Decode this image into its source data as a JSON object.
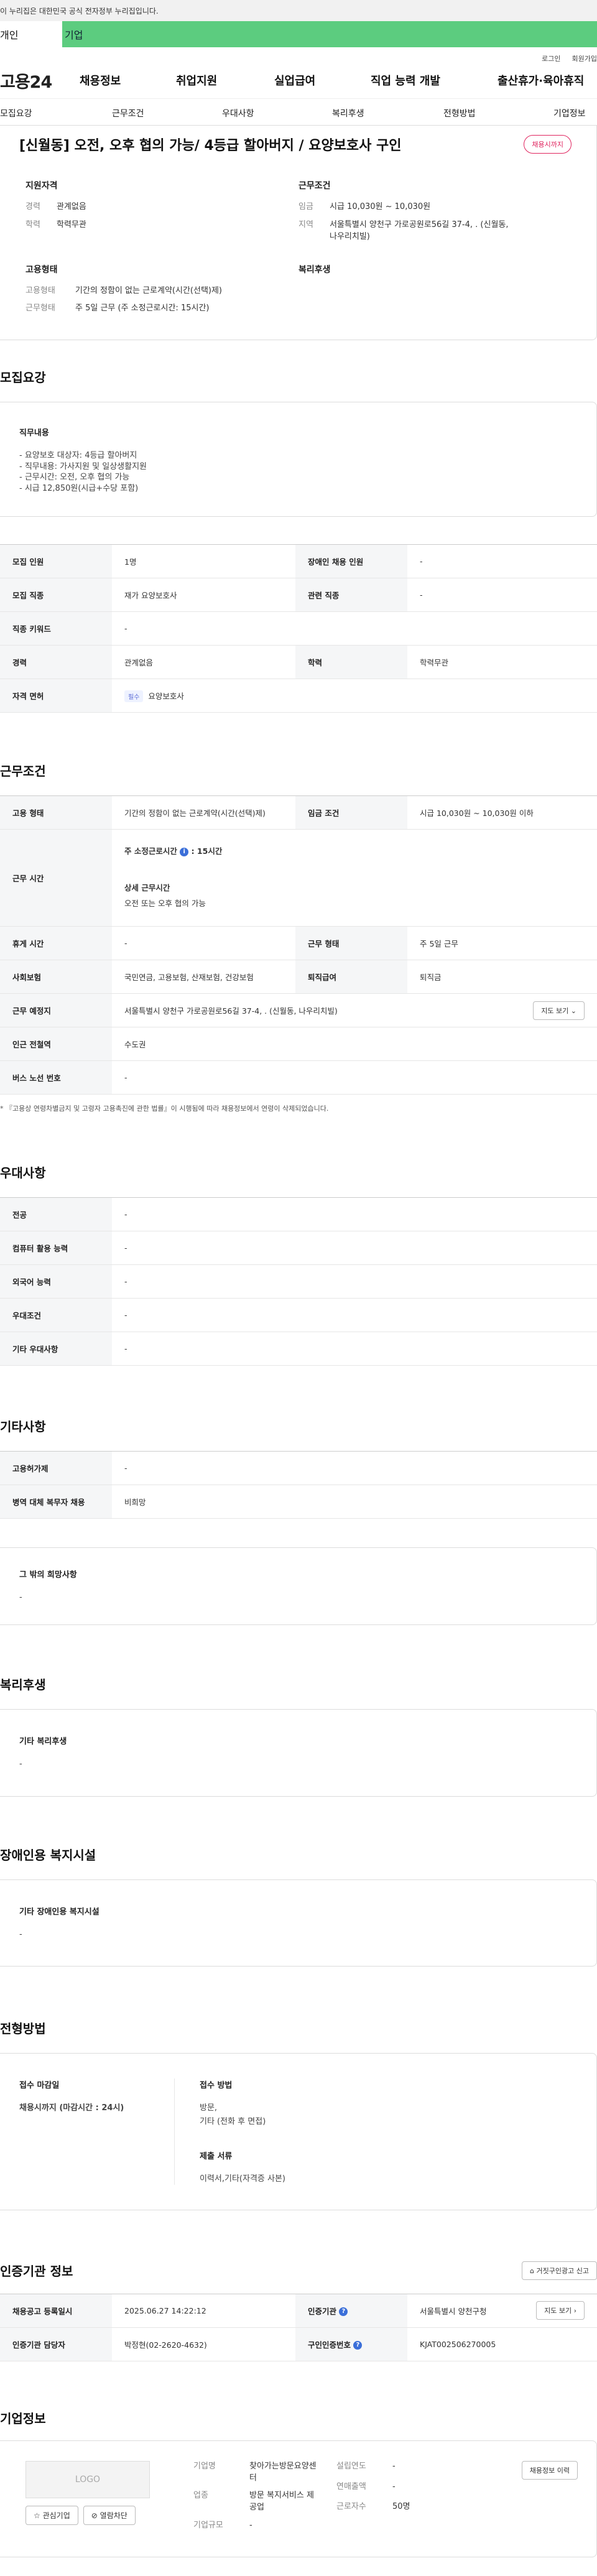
{
  "gov_bar": {
    "text": "이 누리집은 대한민국 공식 전자정부 누리집입니다."
  },
  "top_tabs": {
    "personal": "개인",
    "company": "기업"
  },
  "util": {
    "login": "로그인",
    "join": "회원가입"
  },
  "gnb": {
    "logo": "고용24",
    "menu": [
      "채용정보",
      "취업지원",
      "실업급여",
      "직업 능력 개발",
      "출산휴가·육아휴직"
    ]
  },
  "subnav": [
    "모집요강",
    "근무조건",
    "우대사항",
    "복리후생",
    "전형방법",
    "기업정보"
  ],
  "job": {
    "title": "[신월동] 오전, 오후 협의 가능/ 4등급 할아버지 / 요양보호사 구인",
    "status_badge": "채용시까지",
    "qual_title": "지원자격",
    "career_label": "경력",
    "career_value": "관계없음",
    "edu_label": "학력",
    "edu_value": "학력무관",
    "cond_title": "근무조건",
    "wage_label": "임금",
    "wage_value": "시급 10,030원 ~ 10,030원",
    "area_label": "지역",
    "area_value": "서울특별시 양천구 가로공원로56길 37-4, . (신월동, 나우리치빌)",
    "emp_title": "고용형태",
    "emp_label": "고용형태",
    "emp_value": "기간의 정함이 없는 근로계약(시간(선택)제)",
    "worktype_label": "근무형태",
    "worktype_value": "주 5일 근무 (주 소정근로시간: 15시간)",
    "welfare_title": "복리후생"
  },
  "recruit": {
    "section_title": "모집요강",
    "duty_title": "직무내용",
    "duty_lines": [
      "- 요양보호 대상자: 4등급 할아버지",
      "- 직무내용: 가사지원 및 일상생활지원",
      "- 근무시간: 오전, 오후 협의 가능",
      "- 시급 12,850원(시급+수당 포함)"
    ],
    "rows": {
      "headcount_label": "모집 인원",
      "headcount_value": "1명",
      "disabled_label": "장애인 채용 인원",
      "disabled_value": "-",
      "job_label": "모집 직종",
      "job_value": "재가 요양보호사",
      "related_label": "관련 직종",
      "related_value": "-",
      "keyword_label": "직종 키워드",
      "keyword_value": "-",
      "career_label": "경력",
      "career_value": "관계없음",
      "edu_label": "학력",
      "edu_value": "학력무관",
      "license_label": "자격 면허",
      "license_tag": "필수",
      "license_value": "요양보호사"
    }
  },
  "work": {
    "section_title": "근무조건",
    "emp_label": "고용 형태",
    "emp_value": "기간의 정함이 없는 근로계약(시간(선택)제)",
    "wage_label": "임금 조건",
    "wage_value": "시급 10,030원 ~ 10,030원 이하",
    "time_label": "근무 시간",
    "hours_label": "주 소정근로시간",
    "hours_info": "i",
    "hours_value": ": 15시간",
    "detail_label": "상세 근무시간",
    "detail_value": "오전 또는 오후 협의 가능",
    "rest_label": "휴게 시간",
    "rest_value": "-",
    "type_label": "근무 형태",
    "type_value": "주 5일 근무",
    "insure_label": "사회보험",
    "insure_value": "국민연금, 고용보험, 산재보험, 건강보험",
    "retire_label": "퇴직급여",
    "retire_value": "퇴직금",
    "place_label": "근무 예정지",
    "place_value": "서울특별시 양천구 가로공원로56길 37-4, . (신월동, 나우리치빌)",
    "map_button": "지도 보기",
    "subway_label": "인근 전철역",
    "subway_value": "수도권",
    "bus_label": "버스 노선 번호",
    "bus_value": "-",
    "note": "* 『고용상 연령차별금지 및 고령자 고용촉진에 관한 법률』이 시행됨에 따라 채용정보에서 연령이 삭제되었습니다."
  },
  "pref": {
    "section_title": "우대사항",
    "rows": [
      {
        "label": "전공",
        "value": "-"
      },
      {
        "label": "컴퓨터 활용 능력",
        "value": "-"
      },
      {
        "label": "외국어 능력",
        "value": "-"
      },
      {
        "label": "우대조건",
        "value": "-"
      },
      {
        "label": "기타 우대사항",
        "value": "-"
      }
    ]
  },
  "etc": {
    "section_title": "기타사항",
    "rows": [
      {
        "label": "고용허가제",
        "value": "-"
      },
      {
        "label": "병역 대체 복무자 채용",
        "value": "비희망"
      }
    ],
    "wish_title": "그 밖의 희망사항",
    "wish_value": "-"
  },
  "welfare": {
    "section_title": "복리후생",
    "box_title": "기타 복리후생",
    "box_value": "-"
  },
  "facility": {
    "section_title": "장애인용 복지시설",
    "box_title": "기타 장애인용 복지시설",
    "box_value": "-"
  },
  "process": {
    "section_title": "전형방법",
    "deadline_title": "접수 마감일",
    "deadline_value": "채용시까지 (마감시간 : 24시)",
    "method_title": "접수 방법",
    "method_value1": "방문,",
    "method_value2": "기타 (전화 후 면접)",
    "docs_title": "제출 서류",
    "docs_value": "이력서,기타(자격증 사본)"
  },
  "agency": {
    "section_title": "인증기관 정보",
    "report_button": "거짓구인광고 신고",
    "reg_label": "채용공고 등록일시",
    "reg_value": "2025.06.27 14:22:12",
    "org_label": "인증기관",
    "org_value": "서울특별시 양천구청",
    "map_button": "지도 보기",
    "manager_label": "인증기관 담당자",
    "manager_value": "박정현(02-2620-4632)",
    "num_label": "구인인증번호",
    "num_value": "KJAT002506270005"
  },
  "company": {
    "section_title": "기업정보",
    "logo_text": "LOGO",
    "fav_button": "관심기업",
    "block_button": "열람차단",
    "name_label": "기업명",
    "name_value": "찾아가는방문요양센터",
    "industry_label": "업종",
    "industry_value": "방문 복지서비스 제공업",
    "size_label": "기업규모",
    "size_value": "-",
    "founded_label": "설립연도",
    "founded_value": "-",
    "sales_label": "연매출액",
    "sales_value": "-",
    "staff_label": "근로자수",
    "staff_value": "50명",
    "history_button": "채용정보 이력"
  }
}
